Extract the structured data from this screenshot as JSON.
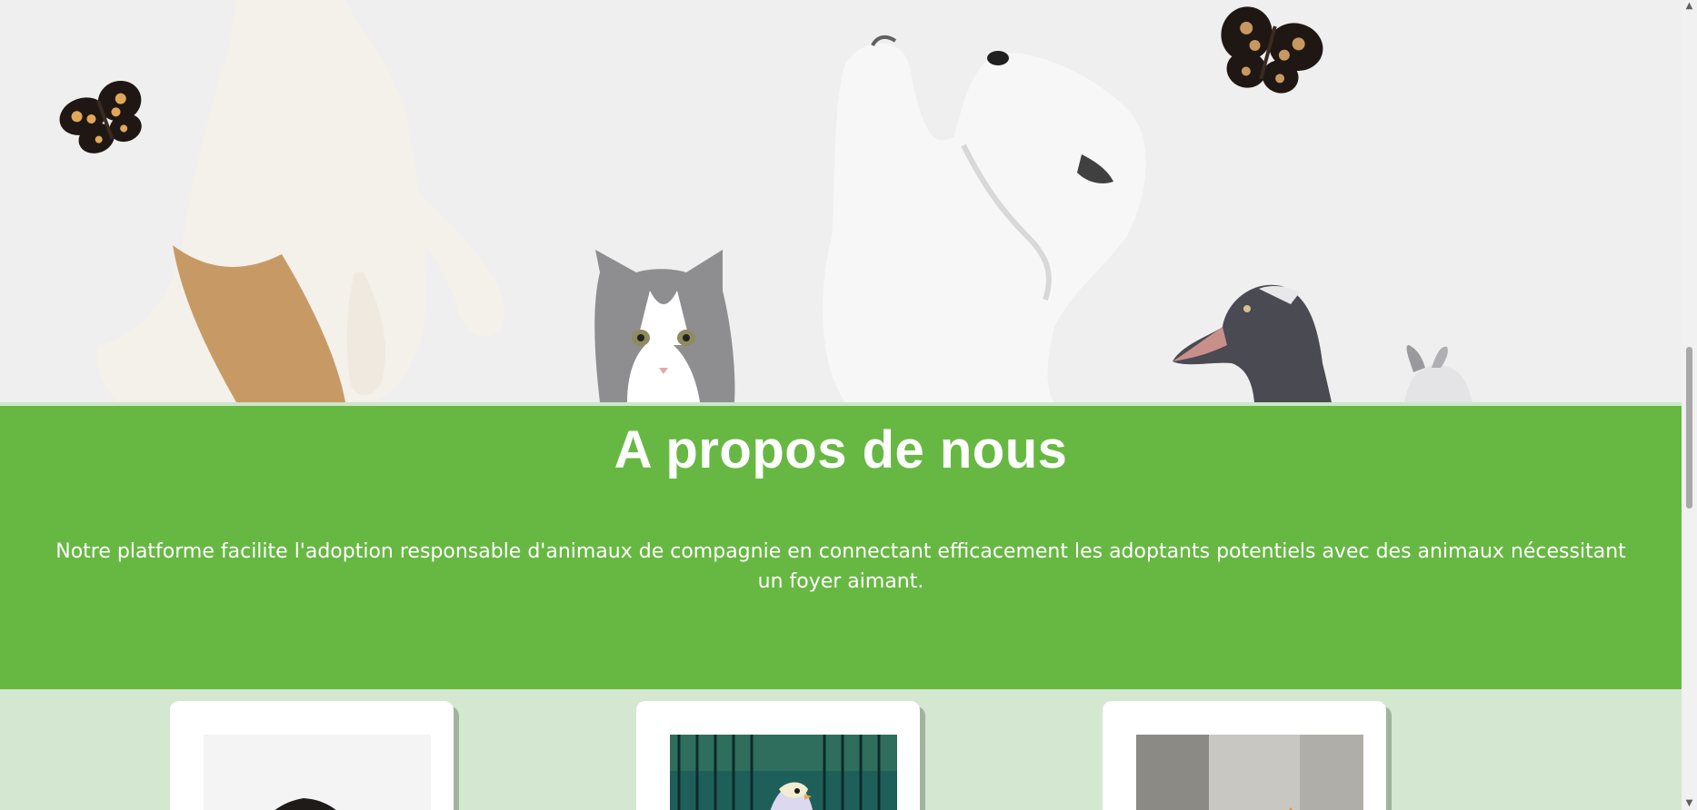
{
  "hero": {
    "image_alt": "Pets: dogs, cat, duck, rabbit and butterflies",
    "background_color": "#efefef"
  },
  "about": {
    "title": "A propos de nous",
    "description": "Notre platforme facilite l'adoption responsable d'animaux de compagnie en connectant efficacement les adoptants potentiels avec des animaux nécessitant un foyer aimant.",
    "background_color": "#67b843"
  },
  "cards": {
    "background_color": "#d4e7d0",
    "items": [
      {
        "image_icon": "dog-photo"
      },
      {
        "image_icon": "parakeet-photo"
      },
      {
        "image_icon": "cat-photo"
      }
    ]
  },
  "scrollbar": {
    "up_icon": "chevron-up-icon",
    "down_icon": "chevron-down-icon"
  }
}
